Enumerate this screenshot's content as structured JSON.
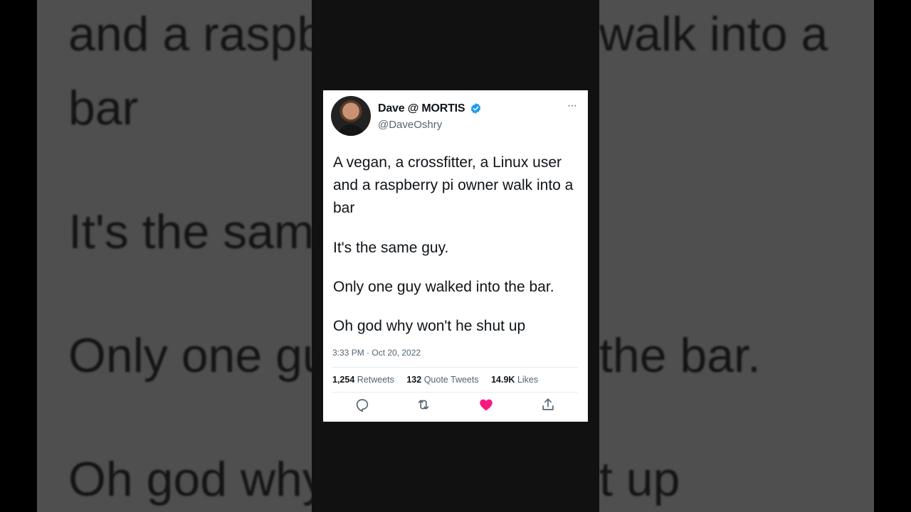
{
  "background_text": [
    "and a raspb",
    "walk into a",
    "bar",
    "It's the sam",
    "Only one gu",
    "the bar.",
    "Oh god why",
    "t up"
  ],
  "tweet": {
    "author_name": "Dave @ MORTIS",
    "handle": "@DaveOshry",
    "paragraphs": [
      "A vegan, a crossfitter, a Linux user and a raspberry pi owner walk into a bar",
      "It's the same guy.",
      "Only one guy walked into the bar.",
      "Oh god why won't he shut up"
    ],
    "timestamp": "3:33 PM · Oct 20, 2022",
    "stats": {
      "retweets_count": "1,254",
      "retweets_label": "Retweets",
      "quotes_count": "132",
      "quotes_label": "Quote Tweets",
      "likes_count": "14.9K",
      "likes_label": "Likes"
    },
    "more_label": "···"
  },
  "colors": {
    "verified": "#1d9bf0",
    "like": "#f91880",
    "icon_gray": "#536471"
  },
  "icons": [
    "verified-badge-icon",
    "more-icon",
    "reply-icon",
    "retweet-icon",
    "like-icon",
    "share-icon"
  ]
}
